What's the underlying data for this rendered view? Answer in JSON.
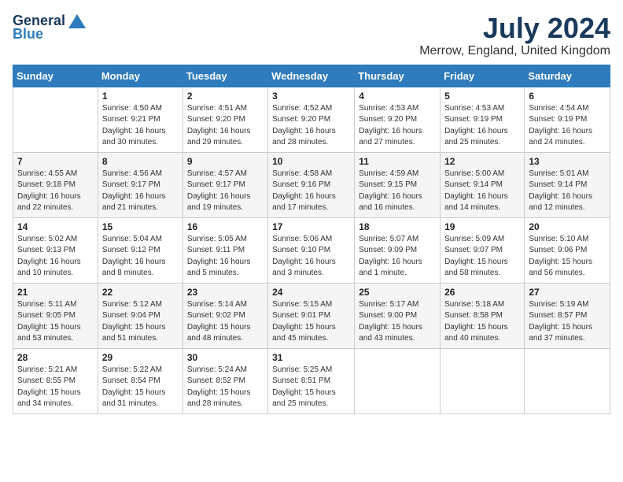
{
  "header": {
    "logo_general": "General",
    "logo_blue": "Blue",
    "month_year": "July 2024",
    "location": "Merrow, England, United Kingdom"
  },
  "weekdays": [
    "Sunday",
    "Monday",
    "Tuesday",
    "Wednesday",
    "Thursday",
    "Friday",
    "Saturday"
  ],
  "weeks": [
    [
      {
        "day": "",
        "info": ""
      },
      {
        "day": "1",
        "info": "Sunrise: 4:50 AM\nSunset: 9:21 PM\nDaylight: 16 hours\nand 30 minutes."
      },
      {
        "day": "2",
        "info": "Sunrise: 4:51 AM\nSunset: 9:20 PM\nDaylight: 16 hours\nand 29 minutes."
      },
      {
        "day": "3",
        "info": "Sunrise: 4:52 AM\nSunset: 9:20 PM\nDaylight: 16 hours\nand 28 minutes."
      },
      {
        "day": "4",
        "info": "Sunrise: 4:53 AM\nSunset: 9:20 PM\nDaylight: 16 hours\nand 27 minutes."
      },
      {
        "day": "5",
        "info": "Sunrise: 4:53 AM\nSunset: 9:19 PM\nDaylight: 16 hours\nand 25 minutes."
      },
      {
        "day": "6",
        "info": "Sunrise: 4:54 AM\nSunset: 9:19 PM\nDaylight: 16 hours\nand 24 minutes."
      }
    ],
    [
      {
        "day": "7",
        "info": "Sunrise: 4:55 AM\nSunset: 9:18 PM\nDaylight: 16 hours\nand 22 minutes."
      },
      {
        "day": "8",
        "info": "Sunrise: 4:56 AM\nSunset: 9:17 PM\nDaylight: 16 hours\nand 21 minutes."
      },
      {
        "day": "9",
        "info": "Sunrise: 4:57 AM\nSunset: 9:17 PM\nDaylight: 16 hours\nand 19 minutes."
      },
      {
        "day": "10",
        "info": "Sunrise: 4:58 AM\nSunset: 9:16 PM\nDaylight: 16 hours\nand 17 minutes."
      },
      {
        "day": "11",
        "info": "Sunrise: 4:59 AM\nSunset: 9:15 PM\nDaylight: 16 hours\nand 16 minutes."
      },
      {
        "day": "12",
        "info": "Sunrise: 5:00 AM\nSunset: 9:14 PM\nDaylight: 16 hours\nand 14 minutes."
      },
      {
        "day": "13",
        "info": "Sunrise: 5:01 AM\nSunset: 9:14 PM\nDaylight: 16 hours\nand 12 minutes."
      }
    ],
    [
      {
        "day": "14",
        "info": "Sunrise: 5:02 AM\nSunset: 9:13 PM\nDaylight: 16 hours\nand 10 minutes."
      },
      {
        "day": "15",
        "info": "Sunrise: 5:04 AM\nSunset: 9:12 PM\nDaylight: 16 hours\nand 8 minutes."
      },
      {
        "day": "16",
        "info": "Sunrise: 5:05 AM\nSunset: 9:11 PM\nDaylight: 16 hours\nand 5 minutes."
      },
      {
        "day": "17",
        "info": "Sunrise: 5:06 AM\nSunset: 9:10 PM\nDaylight: 16 hours\nand 3 minutes."
      },
      {
        "day": "18",
        "info": "Sunrise: 5:07 AM\nSunset: 9:09 PM\nDaylight: 16 hours\nand 1 minute."
      },
      {
        "day": "19",
        "info": "Sunrise: 5:09 AM\nSunset: 9:07 PM\nDaylight: 15 hours\nand 58 minutes."
      },
      {
        "day": "20",
        "info": "Sunrise: 5:10 AM\nSunset: 9:06 PM\nDaylight: 15 hours\nand 56 minutes."
      }
    ],
    [
      {
        "day": "21",
        "info": "Sunrise: 5:11 AM\nSunset: 9:05 PM\nDaylight: 15 hours\nand 53 minutes."
      },
      {
        "day": "22",
        "info": "Sunrise: 5:12 AM\nSunset: 9:04 PM\nDaylight: 15 hours\nand 51 minutes."
      },
      {
        "day": "23",
        "info": "Sunrise: 5:14 AM\nSunset: 9:02 PM\nDaylight: 15 hours\nand 48 minutes."
      },
      {
        "day": "24",
        "info": "Sunrise: 5:15 AM\nSunset: 9:01 PM\nDaylight: 15 hours\nand 45 minutes."
      },
      {
        "day": "25",
        "info": "Sunrise: 5:17 AM\nSunset: 9:00 PM\nDaylight: 15 hours\nand 43 minutes."
      },
      {
        "day": "26",
        "info": "Sunrise: 5:18 AM\nSunset: 8:58 PM\nDaylight: 15 hours\nand 40 minutes."
      },
      {
        "day": "27",
        "info": "Sunrise: 5:19 AM\nSunset: 8:57 PM\nDaylight: 15 hours\nand 37 minutes."
      }
    ],
    [
      {
        "day": "28",
        "info": "Sunrise: 5:21 AM\nSunset: 8:55 PM\nDaylight: 15 hours\nand 34 minutes."
      },
      {
        "day": "29",
        "info": "Sunrise: 5:22 AM\nSunset: 8:54 PM\nDaylight: 15 hours\nand 31 minutes."
      },
      {
        "day": "30",
        "info": "Sunrise: 5:24 AM\nSunset: 8:52 PM\nDaylight: 15 hours\nand 28 minutes."
      },
      {
        "day": "31",
        "info": "Sunrise: 5:25 AM\nSunset: 8:51 PM\nDaylight: 15 hours\nand 25 minutes."
      },
      {
        "day": "",
        "info": ""
      },
      {
        "day": "",
        "info": ""
      },
      {
        "day": "",
        "info": ""
      }
    ]
  ]
}
